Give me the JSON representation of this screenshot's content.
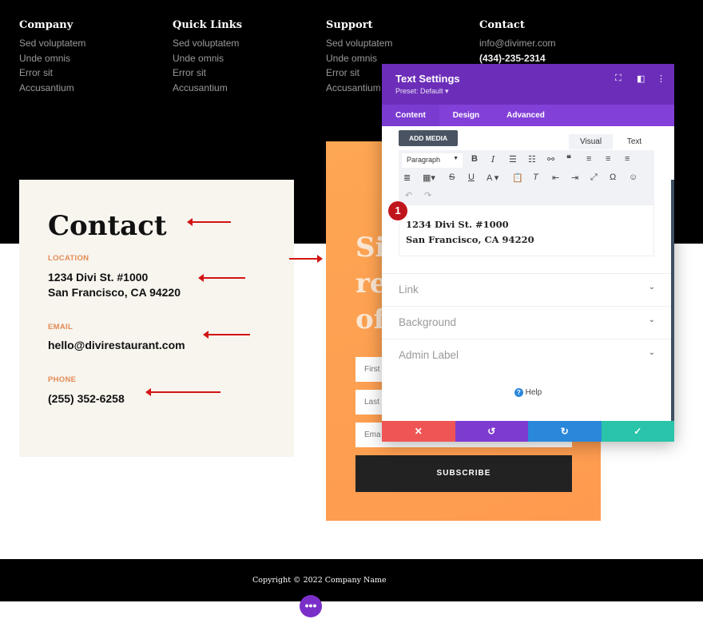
{
  "footer_cols": [
    {
      "title": "Company",
      "items": [
        "Sed voluptatem",
        "Unde omnis",
        "Error sit",
        "Accusantium"
      ]
    },
    {
      "title": "Quick Links",
      "items": [
        "Sed voluptatem",
        "Unde omnis",
        "Error sit",
        "Accusantium"
      ]
    },
    {
      "title": "Support",
      "items": [
        "Sed voluptatem",
        "Unde omnis",
        "Error sit",
        "Accusantium"
      ]
    },
    {
      "title": "Contact",
      "items": [
        "info@divimer.com",
        "(434)-235-2314"
      ]
    }
  ],
  "contact": {
    "title": "Contact",
    "location_label": "LOCATION",
    "location_1": "1234 Divi St. #1000",
    "location_2": "San Francisco, CA 94220",
    "email_label": "EMAIL",
    "email": "hello@divirestaurant.com",
    "phone_label": "PHONE",
    "phone": "(255) 352-6258"
  },
  "signup": {
    "heading": [
      "Si",
      "re",
      "of"
    ],
    "first": "First",
    "last": "Last",
    "email": "Ema",
    "subscribe": "SUBSCRIBE"
  },
  "copyright": "Copyright © 2022 Company Name",
  "modal": {
    "title": "Text Settings",
    "preset": "Preset: Default ▾",
    "tabs": [
      "Content",
      "Design",
      "Advanced"
    ],
    "add_media": "ADD MEDIA",
    "visual": "Visual",
    "text": "Text",
    "paragraph": "Paragraph",
    "badge": "1",
    "content_1": "1234 Divi St. #1000",
    "content_2": "San Francisco, CA 94220",
    "sections": [
      "Link",
      "Background",
      "Admin Label"
    ],
    "help": "Help"
  },
  "colors": {
    "purple": "#6c2eb9",
    "cancel": "#ef5555",
    "undo": "#7e3bd0",
    "redo": "#2b87da",
    "save": "#29c4a9",
    "accent": "#e38b55"
  }
}
